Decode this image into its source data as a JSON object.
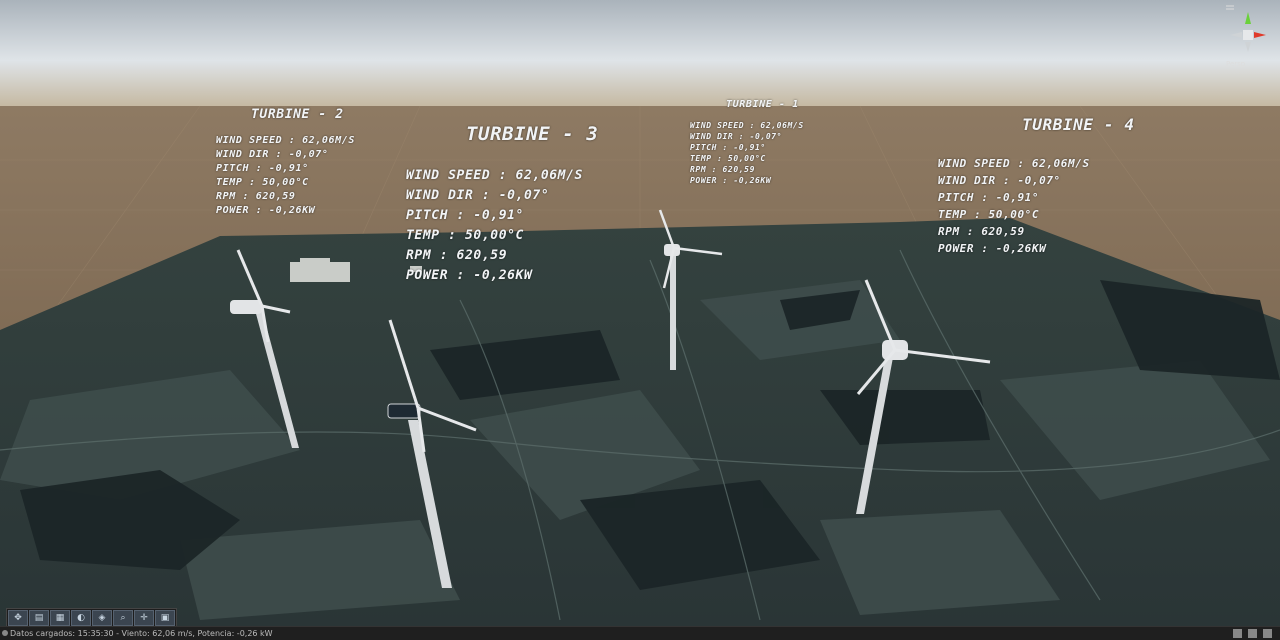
{
  "panels": {
    "t1": {
      "title": "TURBINE - 1",
      "wind_speed": "WIND SPEED : 62,06M/S",
      "wind_dir": "WIND DIR : -0,07°",
      "pitch": "PITCH :   -0,91°",
      "temp": "TEMP :   50,00°C",
      "rpm": "RPM :    620,59",
      "power": "POWER : -0,26KW"
    },
    "t2": {
      "title": "TURBINE - 2",
      "wind_speed": "WIND SPEED : 62,06M/S",
      "wind_dir": "WIND DIR : -0,07°",
      "pitch": "PITCH :   -0,91°",
      "temp": "TEMP :   50,00°C",
      "rpm": "RPM :    620,59",
      "power": "POWER : -0,26KW"
    },
    "t3": {
      "title": "TURBINE - 3",
      "wind_speed": "WIND SPEED : 62,06M/S",
      "wind_dir": "WIND DIR : -0,07°",
      "pitch": "PITCH :   -0,91°",
      "temp": "TEMP :   50,00°C",
      "rpm": "RPM :    620,59",
      "power": "POWER : -0,26KW"
    },
    "t4": {
      "title": "TURBINE - 4",
      "wind_speed": "WIND SPEED : 62,06M/S",
      "wind_dir": "WIND DIR : -0,07°",
      "pitch": "PITCH :   -0,91°",
      "temp": "TEMP :   50,00°C",
      "rpm": "RPM :    620,59",
      "power": "POWER : -0,26KW"
    }
  },
  "gizmo": {
    "label": "Persp"
  },
  "toolbar": {
    "tools": [
      "move-tool-icon",
      "grid-tool-icon",
      "layers-tool-icon",
      "lighting-tool-icon",
      "effects-tool-icon",
      "zoom-tool-icon",
      "pan-tool-icon",
      "camera-tool-icon"
    ]
  },
  "status": {
    "text": "Datos cargados: 15:35:30 - Viento: 62,06 m/s, Potencia: -0,26 kW"
  },
  "colors": {
    "sky_top": "#aab3bb",
    "horizon": "#c3b59c",
    "ground_far": "#8b7257",
    "terrain": "#2c3a3a",
    "field": "#3b4a48",
    "forest": "#1c2628",
    "text": "#f2f4f6",
    "gizmo_x": "#e03a2a",
    "gizmo_y": "#6ad13a"
  }
}
